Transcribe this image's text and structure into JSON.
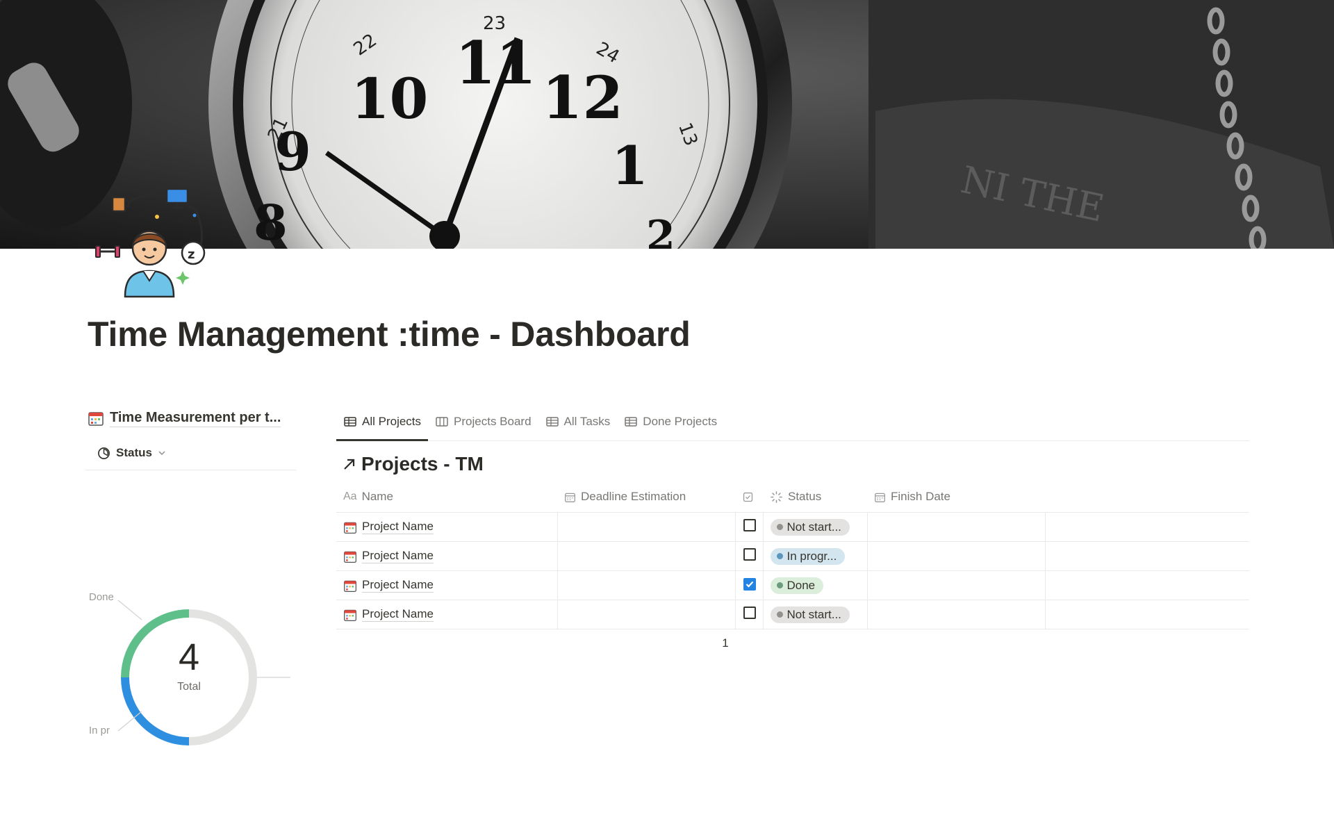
{
  "page": {
    "title": "Time Management :time - Dashboard"
  },
  "linked_view": {
    "title": "Time Measurement per t...",
    "filter_label": "Status",
    "icons": {
      "title_icon": "calendar-icon",
      "filter_icon": "status-clock-icon",
      "chevron": "chevron-down-icon"
    }
  },
  "chart_data": {
    "type": "pie",
    "categories": [
      "Done",
      "In progress",
      "Not started"
    ],
    "values": [
      1,
      1,
      2
    ],
    "visible_labels": [
      "Done",
      "In pr"
    ],
    "center_value": "4",
    "center_label": "Total",
    "colors": [
      "#5fbf8a",
      "#2e8fe0",
      "#e3e3e1"
    ]
  },
  "database": {
    "tabs": [
      {
        "label": "All Projects",
        "icon": "table-icon",
        "active": true
      },
      {
        "label": "Projects Board",
        "icon": "board-icon",
        "active": false
      },
      {
        "label": "All Tasks",
        "icon": "table-icon",
        "active": false
      },
      {
        "label": "Done Projects",
        "icon": "table-icon",
        "active": false
      }
    ],
    "title": "Projects - TM",
    "columns": {
      "name": "Name",
      "deadline": "Deadline Estimation",
      "check": "",
      "status": "Status",
      "finish": "Finish Date"
    },
    "rows": [
      {
        "name": "Project Name",
        "deadline": "",
        "checked": false,
        "status": "Not start...",
        "finish": ""
      },
      {
        "name": "Project Name",
        "deadline": "",
        "checked": false,
        "status": "In progr...",
        "finish": ""
      },
      {
        "name": "Project Name",
        "deadline": "",
        "checked": true,
        "status": "Done",
        "finish": ""
      },
      {
        "name": "Project Name",
        "deadline": "",
        "checked": false,
        "status": "Not start...",
        "finish": ""
      }
    ],
    "count": "1",
    "status_colors": {
      "Not start...": {
        "bg": "#e3e2e0",
        "dot": "#91918e"
      },
      "In progr...": {
        "bg": "#d3e5ef",
        "dot": "#5b97bd"
      },
      "Done": {
        "bg": "#dbeddb",
        "dot": "#6c9b7d"
      }
    }
  }
}
